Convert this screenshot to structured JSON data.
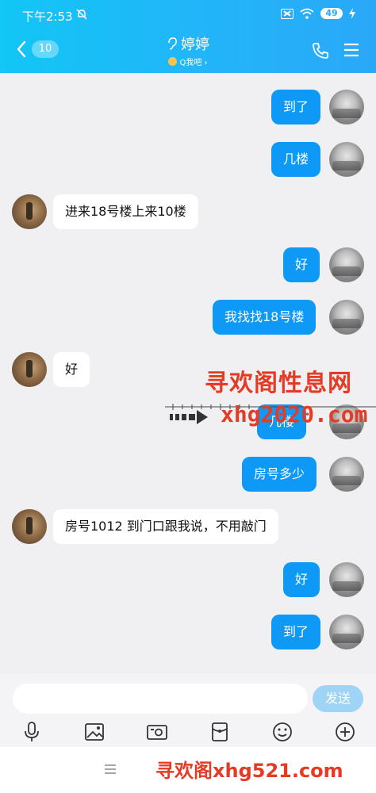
{
  "status": {
    "time": "下午2:53",
    "battery": "49"
  },
  "header": {
    "unread_count": "10",
    "contact_name": "婷婷",
    "contact_sub": "Q我吧 ›"
  },
  "messages": [
    {
      "side": "out",
      "text": "到了"
    },
    {
      "side": "out",
      "text": "几楼"
    },
    {
      "side": "in",
      "text": "进来18号楼上来10楼"
    },
    {
      "side": "out",
      "text": "好"
    },
    {
      "side": "out",
      "text": "我找找18号楼"
    },
    {
      "side": "in",
      "text": "好"
    },
    {
      "side": "out",
      "text": "几楼"
    },
    {
      "side": "out",
      "text": "房号多少"
    },
    {
      "side": "in",
      "text": "房号1012 到门口跟我说，不用敲门"
    },
    {
      "side": "out",
      "text": "好"
    },
    {
      "side": "out",
      "text": "到了"
    }
  ],
  "watermark": {
    "title": "寻欢阁性息网",
    "url": "xhg2020.com",
    "bottom": "寻欢阁xhg521.com"
  },
  "input": {
    "placeholder": "",
    "send_label": "发送"
  },
  "toolbar_icons": [
    "microphone-icon",
    "image-icon",
    "camera-icon",
    "red-packet-icon",
    "emoji-icon",
    "plus-icon"
  ],
  "colors": {
    "header": "#21b6f8",
    "outgoing_bubble": "#0e99f6",
    "watermark": "#e53b24"
  }
}
